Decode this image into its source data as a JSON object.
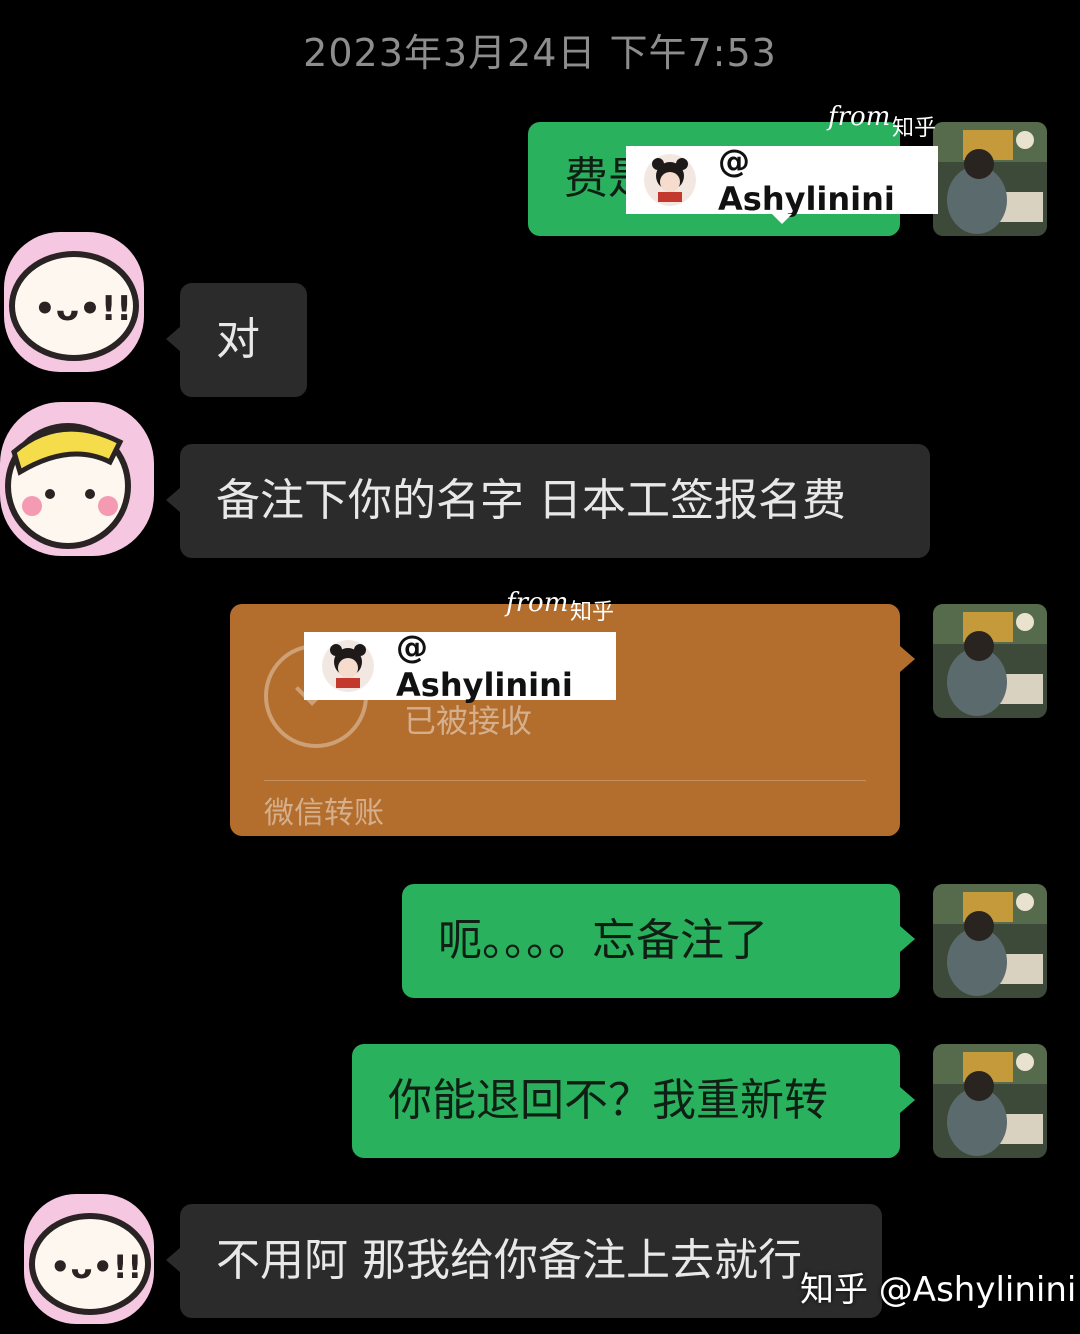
{
  "timestamp": "2023年3月24日 下午7:53",
  "colors": {
    "background": "#000000",
    "bubble_sent": "#2ab15d",
    "bubble_received": "#2b2b2b",
    "transfer": "#b36d2c"
  },
  "messages": [
    {
      "side": "right",
      "type": "text",
      "text": "费是"
    },
    {
      "side": "left",
      "type": "text",
      "text": "对"
    },
    {
      "side": "left",
      "type": "text",
      "text": "备注下你的名字 日本工签报名费"
    },
    {
      "side": "right",
      "type": "transfer",
      "status": "已被接收",
      "footer": "微信转账"
    },
    {
      "side": "right",
      "type": "text",
      "text": "呃。。。。忘备注了"
    },
    {
      "side": "right",
      "type": "text",
      "text": "你能退回不？我重新转"
    },
    {
      "side": "left",
      "type": "text",
      "text": "不用阿 那我给你备注上去就行"
    }
  ],
  "watermarks": {
    "from_label": "from",
    "site": "知乎",
    "handle": "@ Ashylinini",
    "corner": "知乎 @Ashylinini"
  },
  "icons": {
    "self_avatar": "reading-person-avatar",
    "peer_avatar_1": "cartoon-speech-avatar",
    "peer_avatar_2": "cartoon-face-avatar",
    "transfer_check": "check-circle-icon"
  }
}
